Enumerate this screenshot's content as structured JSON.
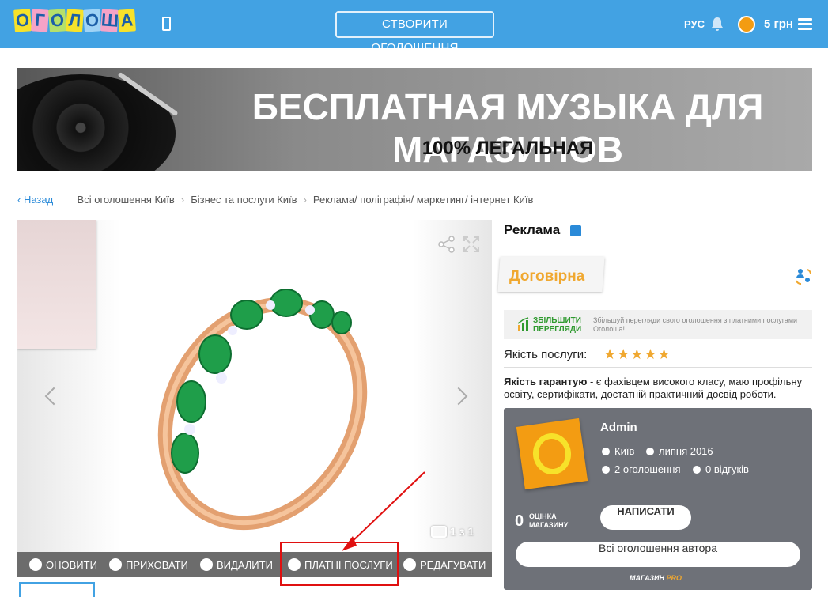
{
  "header": {
    "logo_letters": [
      "О",
      "Г",
      "О",
      "Л",
      "О",
      "Ш",
      "А"
    ],
    "logo_colors": [
      "#f7e22a",
      "#f5a3c7",
      "#b5e06a",
      "#f7e22a",
      "#9fd3f5",
      "#f5a3c7",
      "#f7e22a"
    ],
    "create_button": "СТВОРИТИ ОГОЛОШЕННЯ",
    "language": "РУС",
    "balance": "5 грн",
    "icons": [
      "phone-icon",
      "bell-icon",
      "coin-icon",
      "menu-icon"
    ]
  },
  "banner": {
    "title": "БЕСПЛАТНАЯ МУЗЫКА ДЛЯ МАГАЗИНОВ",
    "subtitle": "100% ЛЕГАЛЬНАЯ"
  },
  "breadcrumbs": {
    "back": "Назад",
    "items": [
      "Всі оголошення Київ",
      "Бізнес та послуги Київ",
      "Реклама/ поліграфія/ маркетинг/ інтернет Київ"
    ]
  },
  "gallery": {
    "photo_counter": "1 з 1",
    "actions": [
      "ОНОВИТИ",
      "ПРИХОВАТИ",
      "ВИДАЛИТИ",
      "ПЛАТНІ ПОСЛУГИ",
      "РЕДАГУВАТИ"
    ]
  },
  "listing": {
    "title": "Реклама",
    "price": "Договірна",
    "boost_title": "ЗБІЛЬШИТИ ПЕРЕГЛЯДИ",
    "boost_text": "Збільшуй перегляди свого оголошення з платними послугами Оголоша!",
    "quality_label": "Якість послуги:",
    "stars": "★★★★★",
    "rating_value": 5,
    "desc_bold": "Якість гарантую",
    "desc_rest": " - є фахівцем високого класу, маю профільну освіту, сертифікати, достатній практичний досвід роботи."
  },
  "seller": {
    "name": "Admin",
    "city": "Київ",
    "since": "липня 2016",
    "ads": "2 оголошення",
    "reviews": "0 відгуків",
    "rating": "0",
    "rating_label": "ОЦІНКА МАГАЗИНУ",
    "write_button": "НАПИСАТИ",
    "all_ads_button": "Всі оголошення автора",
    "pro_badge_a": "МАГАЗИН",
    "pro_badge_b": "PRO"
  },
  "colors": {
    "header_bg": "#42a2e3",
    "price": "#f0a830",
    "seller_panel": "#6e7178",
    "highlight": "#e01010"
  }
}
